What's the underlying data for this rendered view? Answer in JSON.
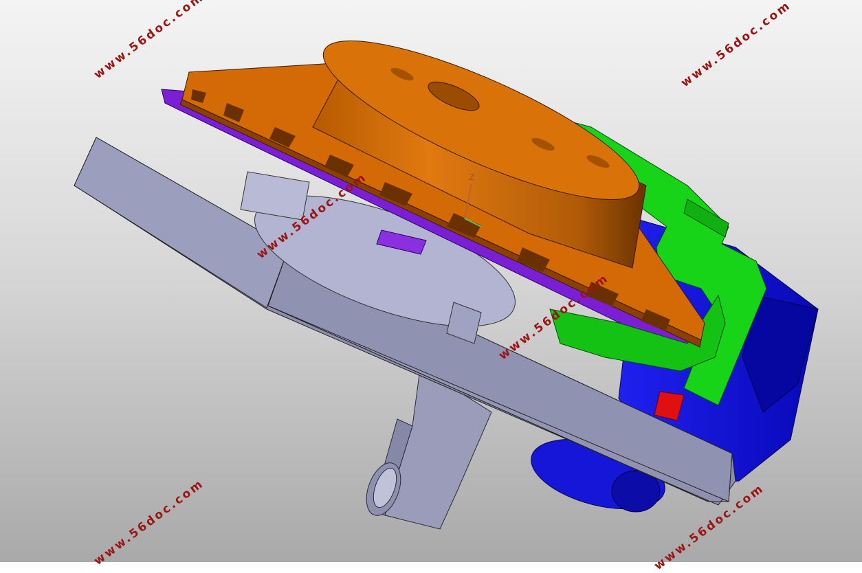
{
  "viewport": {
    "background_top": "#f4f4f4",
    "background_bottom": "#a9a9a9"
  },
  "model": {
    "parts": [
      {
        "name": "base-plate",
        "color": "#9799b8"
      },
      {
        "name": "bracket-arm",
        "color": "#9a9cba"
      },
      {
        "name": "brake-disc",
        "color": "#d46a05"
      },
      {
        "name": "hub",
        "color": "#d06a00"
      },
      {
        "name": "backing-plate",
        "color": "#7b1fd6"
      },
      {
        "name": "caliper-bracket",
        "color": "#18d418"
      },
      {
        "name": "caliper-housing",
        "color": "#1010e0"
      },
      {
        "name": "bleed-pin",
        "color": "#e01010"
      }
    ],
    "axis_triad_label": "Z"
  },
  "watermarks": [
    "www.56doc.com",
    "www.56doc.com",
    "www.56doc.com",
    "www.56doc.com",
    "www.56doc.com",
    "www.56doc.com"
  ]
}
